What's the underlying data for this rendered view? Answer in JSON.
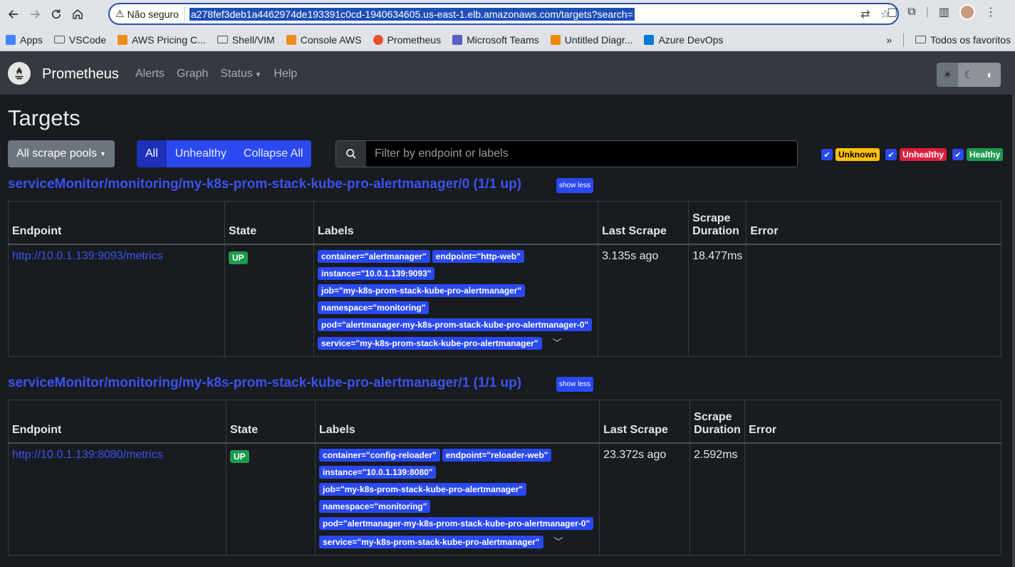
{
  "browser": {
    "security_label": "Não seguro",
    "url": "a278fef3deb1a4462974de193391c0cd-1940634605.us-east-1.elb.amazonaws.com/targets?search=",
    "bookmarks": [
      {
        "label": "Apps",
        "icon": "apps-grid-icon"
      },
      {
        "label": "VSCode",
        "icon": "folder-icon"
      },
      {
        "label": "AWS Pricing C...",
        "icon": "aws-icon"
      },
      {
        "label": "Shell/VIM",
        "icon": "folder-icon"
      },
      {
        "label": "Console  AWS",
        "icon": "aws-icon"
      },
      {
        "label": "Prometheus",
        "icon": "prometheus-icon"
      },
      {
        "label": "Microsoft Teams",
        "icon": "teams-icon"
      },
      {
        "label": "Untitled Diagr...",
        "icon": "drawio-icon"
      },
      {
        "label": "Azure DevOps",
        "icon": "azure-devops-icon"
      }
    ],
    "all_bookmarks": "Todos os favoritos",
    "overflow": "»"
  },
  "navbar": {
    "brand": "Prometheus",
    "links": [
      "Alerts",
      "Graph",
      "Status",
      "Help"
    ]
  },
  "page": {
    "title": "Targets",
    "pools_button": "All scrape pools",
    "filters": [
      "All",
      "Unhealthy",
      "Collapse All"
    ],
    "search_placeholder": "Filter by endpoint or labels",
    "health": [
      {
        "label": "Unknown",
        "color": "#ffc107",
        "text_color": "#000000"
      },
      {
        "label": "Unhealthy",
        "color": "#dc1f3c",
        "text_color": "#ffffff"
      },
      {
        "label": "Healthy",
        "color": "#1d9b4c",
        "text_color": "#ffffff"
      }
    ],
    "show_less": "show less",
    "columns": [
      "Endpoint",
      "State",
      "Labels",
      "Last Scrape",
      "Scrape Duration",
      "Error"
    ]
  },
  "sections": [
    {
      "title": "serviceMonitor/monitoring/my-k8s-prom-stack-kube-pro-alertmanager/0 (1/1 up)",
      "endpoint": "http://10.0.1.139:9093/metrics",
      "state": "UP",
      "labels": [
        "container=\"alertmanager\"",
        "endpoint=\"http-web\"",
        "instance=\"10.0.1.139:9093\"",
        "job=\"my-k8s-prom-stack-kube-pro-alertmanager\"",
        "namespace=\"monitoring\"",
        "pod=\"alertmanager-my-k8s-prom-stack-kube-pro-alertmanager-0\"",
        "service=\"my-k8s-prom-stack-kube-pro-alertmanager\""
      ],
      "last_scrape": "3.135s ago",
      "duration": "18.477ms",
      "error": ""
    },
    {
      "title": "serviceMonitor/monitoring/my-k8s-prom-stack-kube-pro-alertmanager/1 (1/1 up)",
      "endpoint": "http://10.0.1.139:8080/metrics",
      "state": "UP",
      "labels": [
        "container=\"config-reloader\"",
        "endpoint=\"reloader-web\"",
        "instance=\"10.0.1.139:8080\"",
        "job=\"my-k8s-prom-stack-kube-pro-alertmanager\"",
        "namespace=\"monitoring\"",
        "pod=\"alertmanager-my-k8s-prom-stack-kube-pro-alertmanager-0\"",
        "service=\"my-k8s-prom-stack-kube-pro-alertmanager\""
      ],
      "last_scrape": "23.372s ago",
      "duration": "2.592ms",
      "error": ""
    }
  ]
}
